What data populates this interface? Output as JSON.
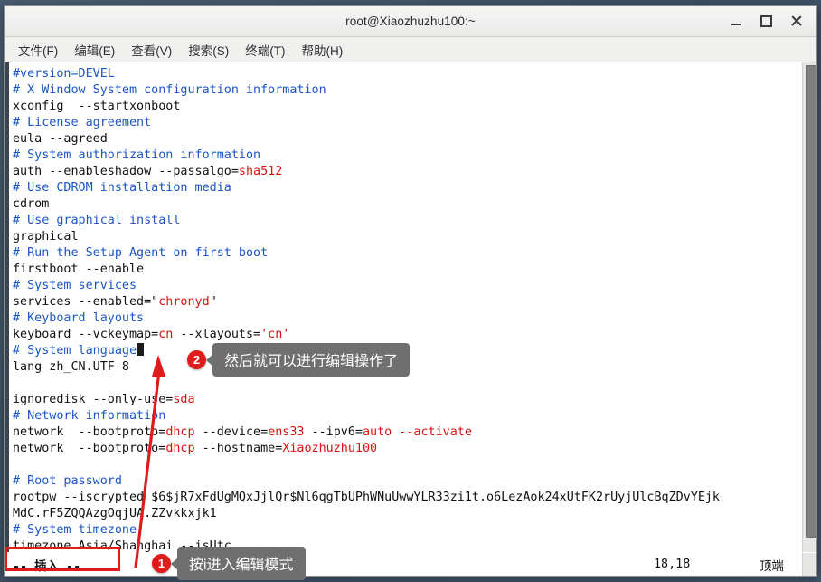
{
  "window": {
    "title": "root@Xiaozhuzhu100:~",
    "buttons": {
      "minimize": "minimize-button",
      "maximize": "maximize-button",
      "close": "close-button"
    }
  },
  "menubar": {
    "items": [
      {
        "label": "文件(F)"
      },
      {
        "label": "编辑(E)"
      },
      {
        "label": "查看(V)"
      },
      {
        "label": "搜索(S)"
      },
      {
        "label": "终端(T)"
      },
      {
        "label": "帮助(H)"
      }
    ]
  },
  "terminal": {
    "lines": [
      [
        {
          "t": "#version=DEVEL",
          "c": "comment"
        }
      ],
      [
        {
          "t": "# X Window System configuration information",
          "c": "comment"
        }
      ],
      [
        {
          "t": "xconfig  --startxonboot",
          "c": "plain"
        }
      ],
      [
        {
          "t": "# License agreement",
          "c": "comment"
        }
      ],
      [
        {
          "t": "eula --agreed",
          "c": "plain"
        }
      ],
      [
        {
          "t": "# System authorization information",
          "c": "comment"
        }
      ],
      [
        {
          "t": "auth --enableshadow --passalgo=",
          "c": "plain"
        },
        {
          "t": "sha512",
          "c": "val"
        }
      ],
      [
        {
          "t": "# Use CDROM installation media",
          "c": "comment"
        }
      ],
      [
        {
          "t": "cdrom",
          "c": "plain"
        }
      ],
      [
        {
          "t": "# Use graphical install",
          "c": "comment"
        }
      ],
      [
        {
          "t": "graphical",
          "c": "plain"
        }
      ],
      [
        {
          "t": "# Run the Setup Agent on first boot",
          "c": "comment"
        }
      ],
      [
        {
          "t": "firstboot --enable",
          "c": "plain"
        }
      ],
      [
        {
          "t": "# System services",
          "c": "comment"
        }
      ],
      [
        {
          "t": "services --enabled=\"",
          "c": "plain"
        },
        {
          "t": "chronyd",
          "c": "val"
        },
        {
          "t": "\"",
          "c": "plain"
        }
      ],
      [
        {
          "t": "# Keyboard layouts",
          "c": "comment"
        }
      ],
      [
        {
          "t": "keyboard --vckeymap=",
          "c": "plain"
        },
        {
          "t": "cn",
          "c": "val"
        },
        {
          "t": " --xlayouts=",
          "c": "plain"
        },
        {
          "t": "'cn'",
          "c": "val"
        }
      ],
      [
        {
          "t": "# System language",
          "c": "comment"
        },
        {
          "t": "CURSOR",
          "c": "cursor"
        }
      ],
      [
        {
          "t": "lang zh_CN.UTF-8",
          "c": "plain"
        }
      ],
      [
        {
          "t": "",
          "c": "plain"
        }
      ],
      [
        {
          "t": "ignoredisk --only-use=",
          "c": "plain"
        },
        {
          "t": "sda",
          "c": "val"
        }
      ],
      [
        {
          "t": "# Network information",
          "c": "comment"
        }
      ],
      [
        {
          "t": "network  --bootproto=",
          "c": "plain"
        },
        {
          "t": "dhcp",
          "c": "val"
        },
        {
          "t": " --device=",
          "c": "plain"
        },
        {
          "t": "ens33",
          "c": "val"
        },
        {
          "t": " --ipv6=",
          "c": "plain"
        },
        {
          "t": "auto",
          "c": "val"
        },
        {
          "t": " --activate",
          "c": "val"
        }
      ],
      [
        {
          "t": "network  --bootproto=",
          "c": "plain"
        },
        {
          "t": "dhcp",
          "c": "val"
        },
        {
          "t": " --hostname=",
          "c": "plain"
        },
        {
          "t": "Xiaozhuzhu100",
          "c": "val"
        }
      ],
      [
        {
          "t": "",
          "c": "plain"
        }
      ],
      [
        {
          "t": "# Root password",
          "c": "comment"
        }
      ],
      [
        {
          "t": "rootpw --iscrypted $6$jR7xFdUgMQxJjlQr$Nl6qgTbUPhWNuUwwYLR33zi1t.o6LezAok24xUtFK2rUyjUlcBqZDvYEjk",
          "c": "plain"
        }
      ],
      [
        {
          "t": "MdC.rF5ZQQAzgOqjUA.ZZvkkxjk1",
          "c": "plain"
        }
      ],
      [
        {
          "t": "# System timezone",
          "c": "comment"
        }
      ],
      [
        {
          "t": "timezone Asia/Shanghai --isUtc",
          "c": "plain"
        }
      ]
    ]
  },
  "statusbar": {
    "mode": "-- 插入 --",
    "position": "18,18",
    "scroll_state": "顶端"
  },
  "annotations": [
    {
      "badge": "1",
      "text": "按i进入编辑模式"
    },
    {
      "badge": "2",
      "text": "然后就可以进行编辑操作了"
    }
  ],
  "colors": {
    "accent_red": "#e01b1b",
    "comment_blue": "#1a56c4",
    "value_red": "#d81111",
    "bubble_gray": "#6f6f6f",
    "desktop": "#41546a"
  }
}
